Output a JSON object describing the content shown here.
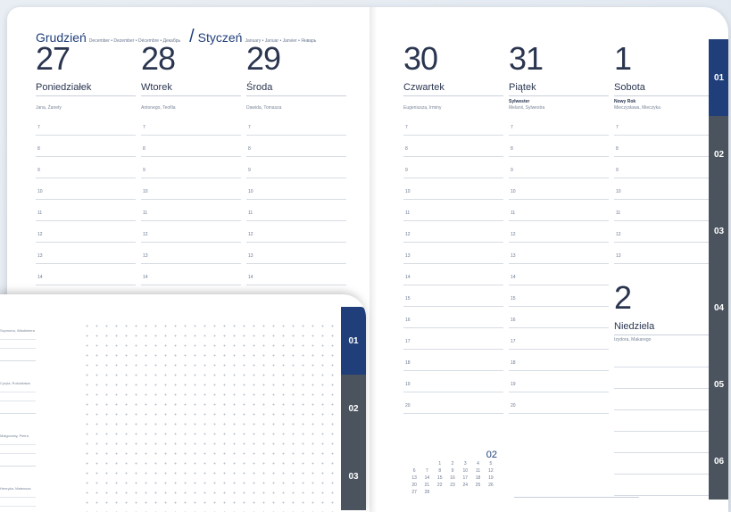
{
  "header": {
    "month1": "Grudzień",
    "month1_sub": "December • Dezember • Décembre • Декабрь",
    "month2": "Styczeń",
    "month2_sub": "January • Januar • Janvier • Январь"
  },
  "days": [
    {
      "num": "27",
      "name": "Poniedziałek",
      "names": "Jana, Żanety",
      "extra": ""
    },
    {
      "num": "28",
      "name": "Wtorek",
      "names": "Antonego, Teofila",
      "extra": ""
    },
    {
      "num": "29",
      "name": "Środa",
      "names": "Dawida, Tomasza",
      "extra": ""
    },
    {
      "num": "30",
      "name": "Czwartek",
      "names": "Eugeniusza, Irminy",
      "extra": ""
    },
    {
      "num": "31",
      "name": "Piątek",
      "names": "Melanii, Sylwestra",
      "extra": "Sylwester"
    },
    {
      "num": "1",
      "name": "Sobota",
      "names": "Mieczysława, Mieczyka",
      "extra": "Nowy Rok"
    }
  ],
  "sunday": {
    "num": "2",
    "name": "Niedziela",
    "names": "Izydora, Makarego"
  },
  "hours_full": [
    "7",
    "8",
    "9",
    "10",
    "11",
    "12",
    "13",
    "14",
    "15",
    "16",
    "17",
    "18",
    "19",
    "20"
  ],
  "tabs": [
    "01",
    "02",
    "03",
    "04",
    "05",
    "06"
  ],
  "minical": {
    "month": "02",
    "days": [
      "",
      "",
      "1",
      "2",
      "3",
      "4",
      "5",
      "6",
      "7",
      "8",
      "9",
      "10",
      "11",
      "12",
      "13",
      "14",
      "15",
      "16",
      "17",
      "18",
      "19",
      "20",
      "21",
      "22",
      "23",
      "24",
      "25",
      "26",
      "27",
      "28"
    ]
  },
  "overlay": {
    "tabs": [
      "01",
      "02",
      "03"
    ],
    "names": [
      "Szymona, Władimiera",
      "Cyryla, Rościsława",
      "Małgorzaty, Pietra",
      "Henryka, Mateusza"
    ]
  },
  "colors": {
    "accent": "#1f3e7a",
    "tab_gray": "#4a535e"
  }
}
